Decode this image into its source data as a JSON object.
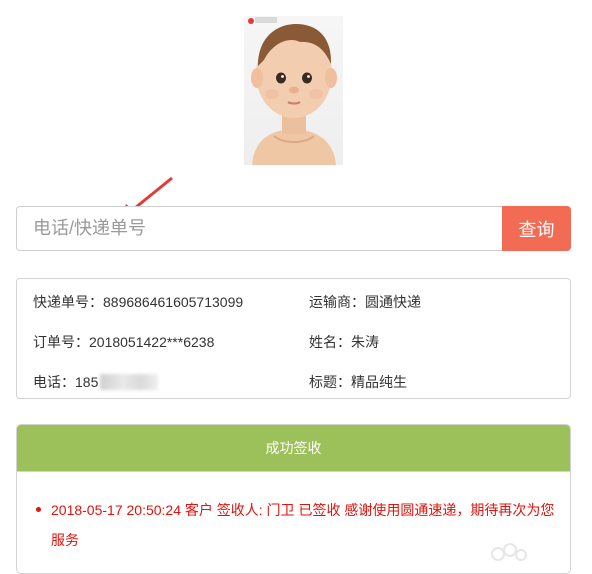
{
  "photo": {
    "alt": "baby photo"
  },
  "search": {
    "placeholder": "电话/快递单号",
    "button_label": "查询",
    "button_color": "#f26b55"
  },
  "info": {
    "tracking_number": "快递单号：889686461605713099",
    "carrier": "运输商：圆通快递",
    "order_number": "订单号：2018051422***6238",
    "name": "姓名：朱涛",
    "phone_prefix": "电话：185",
    "title": "标题：精品纯生"
  },
  "status": {
    "header": "成功签收",
    "header_color": "#9dc15a",
    "events": [
      "2018-05-17 20:50:24 客户 签收人: 门卫 已签收 感谢使用圆通速递，期待再次为您服务"
    ],
    "event_color": "#e3120b"
  },
  "icons": {
    "arrow": "red-arrow-icon",
    "watermark": "watermark-icon",
    "logo": "photo-logo-icon"
  }
}
